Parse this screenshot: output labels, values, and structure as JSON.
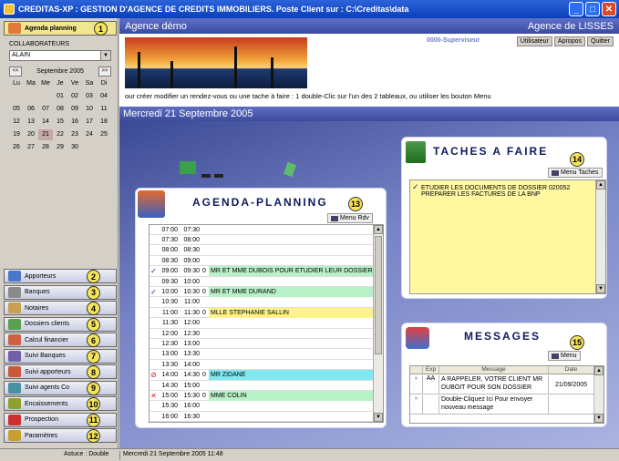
{
  "window": {
    "title": "CREDITAS-XP : GESTION D'AGENCE DE CREDITS IMMOBILIERS.  Poste Client sur : C:\\Creditas\\data",
    "buttons": [
      "_",
      "□",
      "✕"
    ]
  },
  "sidebar": {
    "agenda_label": "Agenda planning",
    "agenda_badge": "1",
    "collaborateurs_label": "COLLABORATEURS",
    "collaborateur_selected": "ALAIN",
    "month_label": "Septembre 2005",
    "prev": "<<",
    "next": ">>",
    "weekdays": [
      "Lu",
      "Ma",
      "Me",
      "Je",
      "Ve",
      "Sa",
      "Di"
    ],
    "days": [
      "",
      "",
      "",
      "01",
      "02",
      "03",
      "04",
      "05",
      "06",
      "07",
      "08",
      "09",
      "10",
      "11",
      "12",
      "13",
      "14",
      "15",
      "16",
      "17",
      "18",
      "19",
      "20",
      "21",
      "22",
      "23",
      "24",
      "25",
      "26",
      "27",
      "28",
      "29",
      "30",
      "",
      ""
    ],
    "today": "21",
    "items": [
      {
        "label": "Apporteurs",
        "badge": "2"
      },
      {
        "label": "Banques",
        "badge": "3"
      },
      {
        "label": "Notaires",
        "badge": "4"
      },
      {
        "label": "Dossiers clients",
        "badge": "5"
      },
      {
        "label": "Calcul financier",
        "badge": "6"
      },
      {
        "label": "Suivi Banques",
        "badge": "7"
      },
      {
        "label": "Suivi apporteurs",
        "badge": "8"
      },
      {
        "label": "Suivi agents Co",
        "badge": "9"
      },
      {
        "label": "Encaissements",
        "badge": "10"
      },
      {
        "label": "Prospection",
        "badge": "11"
      },
      {
        "label": "Paramètres",
        "badge": "12"
      }
    ]
  },
  "header": {
    "agence_left": "Agence démo",
    "agence_right": "Agence de LISSES",
    "supervisor": "0000-Superviseur",
    "tabs": [
      "Utilisateur",
      "Apropos",
      "Quitter"
    ],
    "instruction": "our créer modifier un rendez-vous ou une tache à faire : 1 double-Clic sur l'un des 2  tableaux, ou utiliser les bouton Menu",
    "date": "Mercredi 21 Septembre 2005"
  },
  "agenda": {
    "title": "AGENDA-PLANNING",
    "badge": "13",
    "menu": "Menu Rdv",
    "rows": [
      {
        "check": "",
        "start": "07:00",
        "end": "07:30",
        "lock": "",
        "desc": "",
        "color": ""
      },
      {
        "check": "",
        "start": "07:30",
        "end": "08:00",
        "lock": "",
        "desc": "",
        "color": ""
      },
      {
        "check": "",
        "start": "08:00",
        "end": "08:30",
        "lock": "",
        "desc": "",
        "color": ""
      },
      {
        "check": "",
        "start": "08:30",
        "end": "09:00",
        "lock": "",
        "desc": "",
        "color": ""
      },
      {
        "check": "✓",
        "start": "09:00",
        "end": "09:30",
        "lock": "0",
        "desc": "MR ET MME DUBOIS POUR ETUDIER LEUR DOSSIER",
        "color": "#b8f0c8"
      },
      {
        "check": "",
        "start": "09:30",
        "end": "10:00",
        "lock": "",
        "desc": "",
        "color": ""
      },
      {
        "check": "✓",
        "start": "10:00",
        "end": "10:30",
        "lock": "0",
        "desc": "MR ET MME DURAND",
        "color": "#b8f0c8"
      },
      {
        "check": "",
        "start": "10:30",
        "end": "11:00",
        "lock": "",
        "desc": "",
        "color": ""
      },
      {
        "check": "",
        "start": "11:00",
        "end": "11:30",
        "lock": "0",
        "desc": "MLLE STEPHANIE SALLIN",
        "color": "#fff38a"
      },
      {
        "check": "",
        "start": "11:30",
        "end": "12:00",
        "lock": "",
        "desc": "",
        "color": ""
      },
      {
        "check": "",
        "start": "12:00",
        "end": "12:30",
        "lock": "",
        "desc": "",
        "color": ""
      },
      {
        "check": "",
        "start": "12:30",
        "end": "13:00",
        "lock": "",
        "desc": "",
        "color": ""
      },
      {
        "check": "",
        "start": "13:00",
        "end": "13:30",
        "lock": "",
        "desc": "",
        "color": ""
      },
      {
        "check": "",
        "start": "13:30",
        "end": "14:00",
        "lock": "",
        "desc": "",
        "color": ""
      },
      {
        "check": "⊘",
        "start": "14:00",
        "end": "14:30",
        "lock": "0",
        "desc": "MR ZIDANE",
        "color": "#7fe8f0"
      },
      {
        "check": "",
        "start": "14:30",
        "end": "15:00",
        "lock": "",
        "desc": "",
        "color": ""
      },
      {
        "check": "✕",
        "start": "15:00",
        "end": "15:30",
        "lock": "0",
        "desc": "MME COLIN",
        "color": "#b8f0c8"
      },
      {
        "check": "",
        "start": "15:30",
        "end": "16:00",
        "lock": "",
        "desc": "",
        "color": ""
      },
      {
        "check": "",
        "start": "16:00",
        "end": "16:30",
        "lock": "",
        "desc": "",
        "color": ""
      }
    ]
  },
  "taches": {
    "title": "TACHES A FAIRE",
    "badge": "14",
    "menu": "Menu Taches",
    "rows": [
      {
        "check": "✓",
        "text": "ETUDIER LES DOCUMENTS DE DOSSIER 020052"
      },
      {
        "check": "",
        "text": "PREPARER LES FACTURES DE LA BNP"
      }
    ]
  },
  "messages": {
    "title": "MESSAGES",
    "badge": "15",
    "menu": "Menu",
    "headers": [
      "",
      "Exp",
      "Message",
      "Date"
    ],
    "rows": [
      {
        "exp": "AA",
        "message": "A RAPPELER, VOTRE CLIENT MR DUBOIT POUR SON DOSSIER",
        "date": "21/09/2005"
      },
      {
        "exp": "",
        "message": "Double-Cliquez Ici Pour envoyer nouveau message",
        "date": ""
      }
    ]
  },
  "status": {
    "left": "Astuce : Double",
    "right": "Mercredi 21 Septembre 2005 11:48"
  },
  "colors": {
    "accent": "#4e5fb5",
    "title_bar": "#0a3fb8",
    "badge": "#f5e35a"
  }
}
